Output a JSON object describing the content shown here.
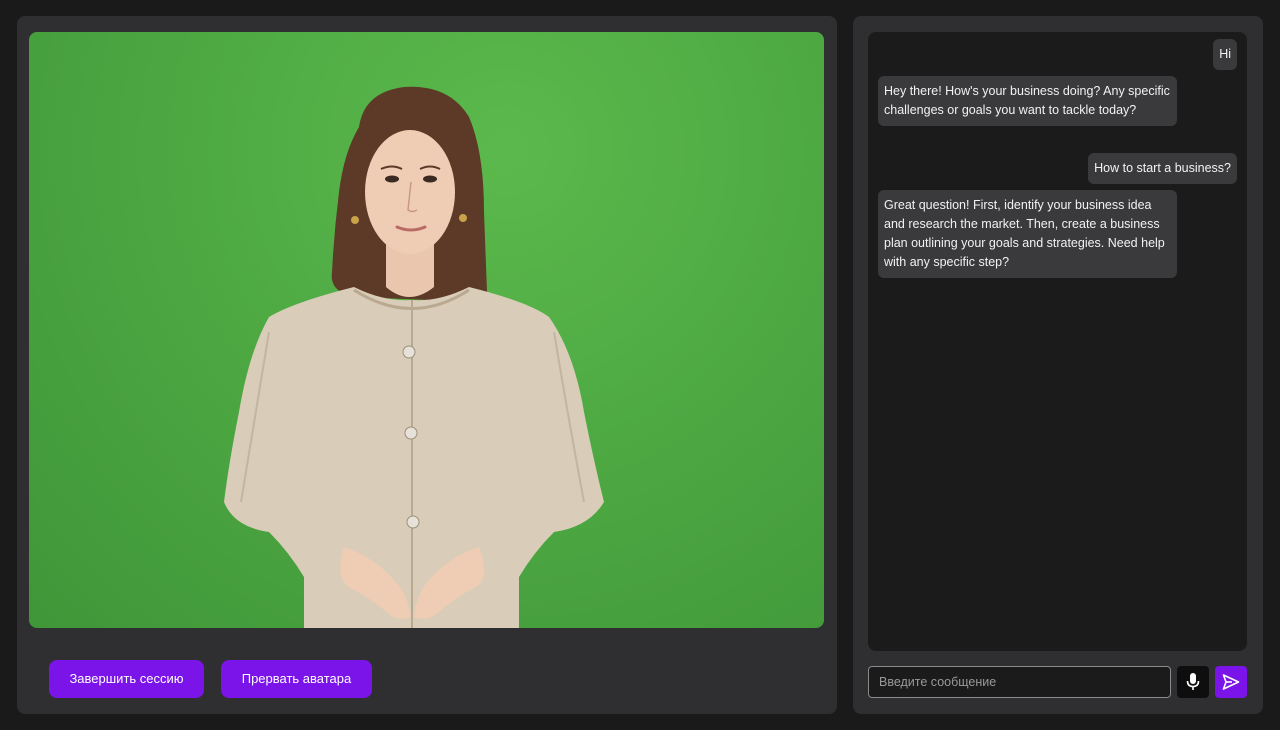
{
  "controls": {
    "end_session_label": "Завершить сессию",
    "interrupt_avatar_label": "Прервать аватара"
  },
  "chat": {
    "messages": [
      {
        "role": "user",
        "text": "Hi"
      },
      {
        "role": "assistant",
        "text": "Hey there! How's your business doing? Any specific challenges or goals you want to tackle today?"
      },
      {
        "role": "user",
        "text": "How to start a business?"
      },
      {
        "role": "assistant",
        "text": "Great question! First, identify your business idea and research the market. Then, create a business plan outlining your goals and strategies. Need help with any specific step?"
      }
    ]
  },
  "composer": {
    "placeholder": "Введите сообщение",
    "value": "",
    "mic_icon": "microphone-icon",
    "send_icon": "send-icon"
  },
  "colors": {
    "accent": "#7b14e8",
    "panel": "#2f2f31",
    "chat_bg": "#1b1b1c",
    "bubble": "#3a3a3c",
    "green_screen": "#4ea943"
  }
}
